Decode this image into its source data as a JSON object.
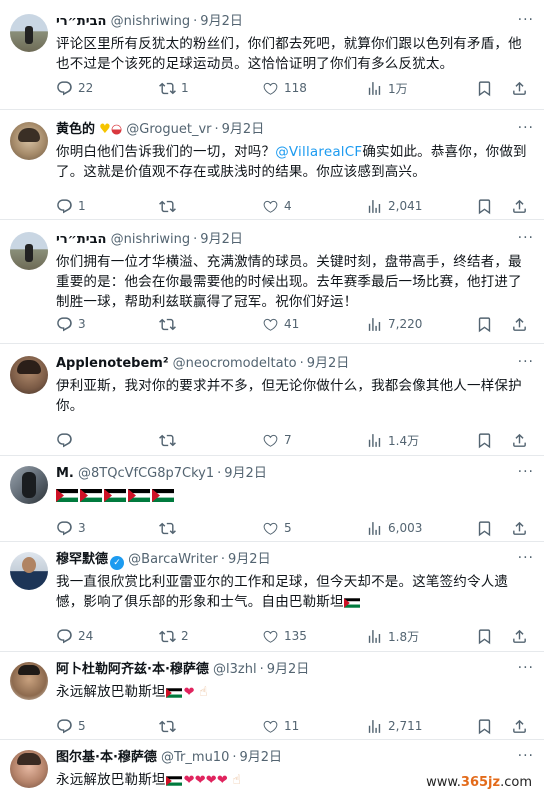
{
  "colors": {
    "accent": "#1d9bf0",
    "muted": "#536471",
    "text": "#0f1419",
    "heart": "#e0245e"
  },
  "icons": [
    "reply-icon",
    "retweet-icon",
    "like-icon",
    "views-icon",
    "bookmark-icon",
    "share-icon",
    "more-icon",
    "verified-icon",
    "palestine-flag-icon",
    "heart-icon"
  ],
  "tweets": [
    {
      "name": "הבית״רי",
      "handle": "@nishriwing",
      "date": "9月2日",
      "text": "评论区里所有反犹太的粉丝们，你们都去死吧，就算你们跟以色列有矛盾，他也不过是个该死的足球运动员。这恰恰证明了你们有多么反犹太。",
      "replies": "22",
      "retweets": "1",
      "likes": "118",
      "views": "1万"
    },
    {
      "name": "黄色的",
      "handle": "@Groguet_vr",
      "date": "9月2日",
      "text_a": "你明白他们告诉我们的一切，对吗？",
      "mention": "@VillarealCF",
      "text_b": "确实如此。恭喜你，你做到了。这就是价值观不存在或肤浅时的结果。你应该感到高兴。",
      "replies": "1",
      "retweets": "",
      "likes": "4",
      "views": "2,041"
    },
    {
      "name": "הבית״רי",
      "handle": "@nishriwing",
      "date": "9月2日",
      "text": "你们拥有一位才华横溢、充满激情的球员。关键时刻，盘带高手，终结者，最重要的是：他会在你最需要他的时候出现。去年赛季最后一场比赛，他打进了制胜一球，帮助利兹联赢得了冠军。祝你们好运！",
      "replies": "3",
      "retweets": "",
      "likes": "41",
      "views": "7,220"
    },
    {
      "name": "Applenotebem²",
      "handle": "@neocromodeltato",
      "date": "9月2日",
      "text": "伊利亚斯，我对你的要求并不多，但无论你做什么，我都会像其他人一样保护你。",
      "replies": "",
      "retweets": "",
      "likes": "7",
      "views": "1.4万"
    },
    {
      "name": "M.",
      "handle": "@8TQcVfCG8p7Cky1",
      "date": "9月2日",
      "text": "",
      "replies": "3",
      "retweets": "",
      "likes": "5",
      "views": "6,003"
    },
    {
      "name": "穆罕默德",
      "handle": "@BarcaWriter",
      "date": "9月2日",
      "text": "我一直很欣赏比利亚雷亚尔的工作和足球，但今天却不是。这笔签约令人遗憾，影响了俱乐部的形象和士气。自由巴勒斯坦",
      "replies": "24",
      "retweets": "2",
      "likes": "135",
      "views": "1.8万"
    },
    {
      "name": "阿卜杜勒阿齐兹·本·穆萨德",
      "handle": "@l3zhl",
      "date": "9月2日",
      "text": "永远解放巴勒斯坦",
      "replies": "5",
      "retweets": "",
      "likes": "11",
      "views": "2,711"
    },
    {
      "name": "图尔基·本·穆萨德",
      "handle": "@Tr_mu10",
      "date": "9月2日",
      "text": "永远解放巴勒斯坦"
    }
  ],
  "watermark": {
    "prefix": "www.",
    "brand": "365jz",
    "suffix": ".com"
  }
}
